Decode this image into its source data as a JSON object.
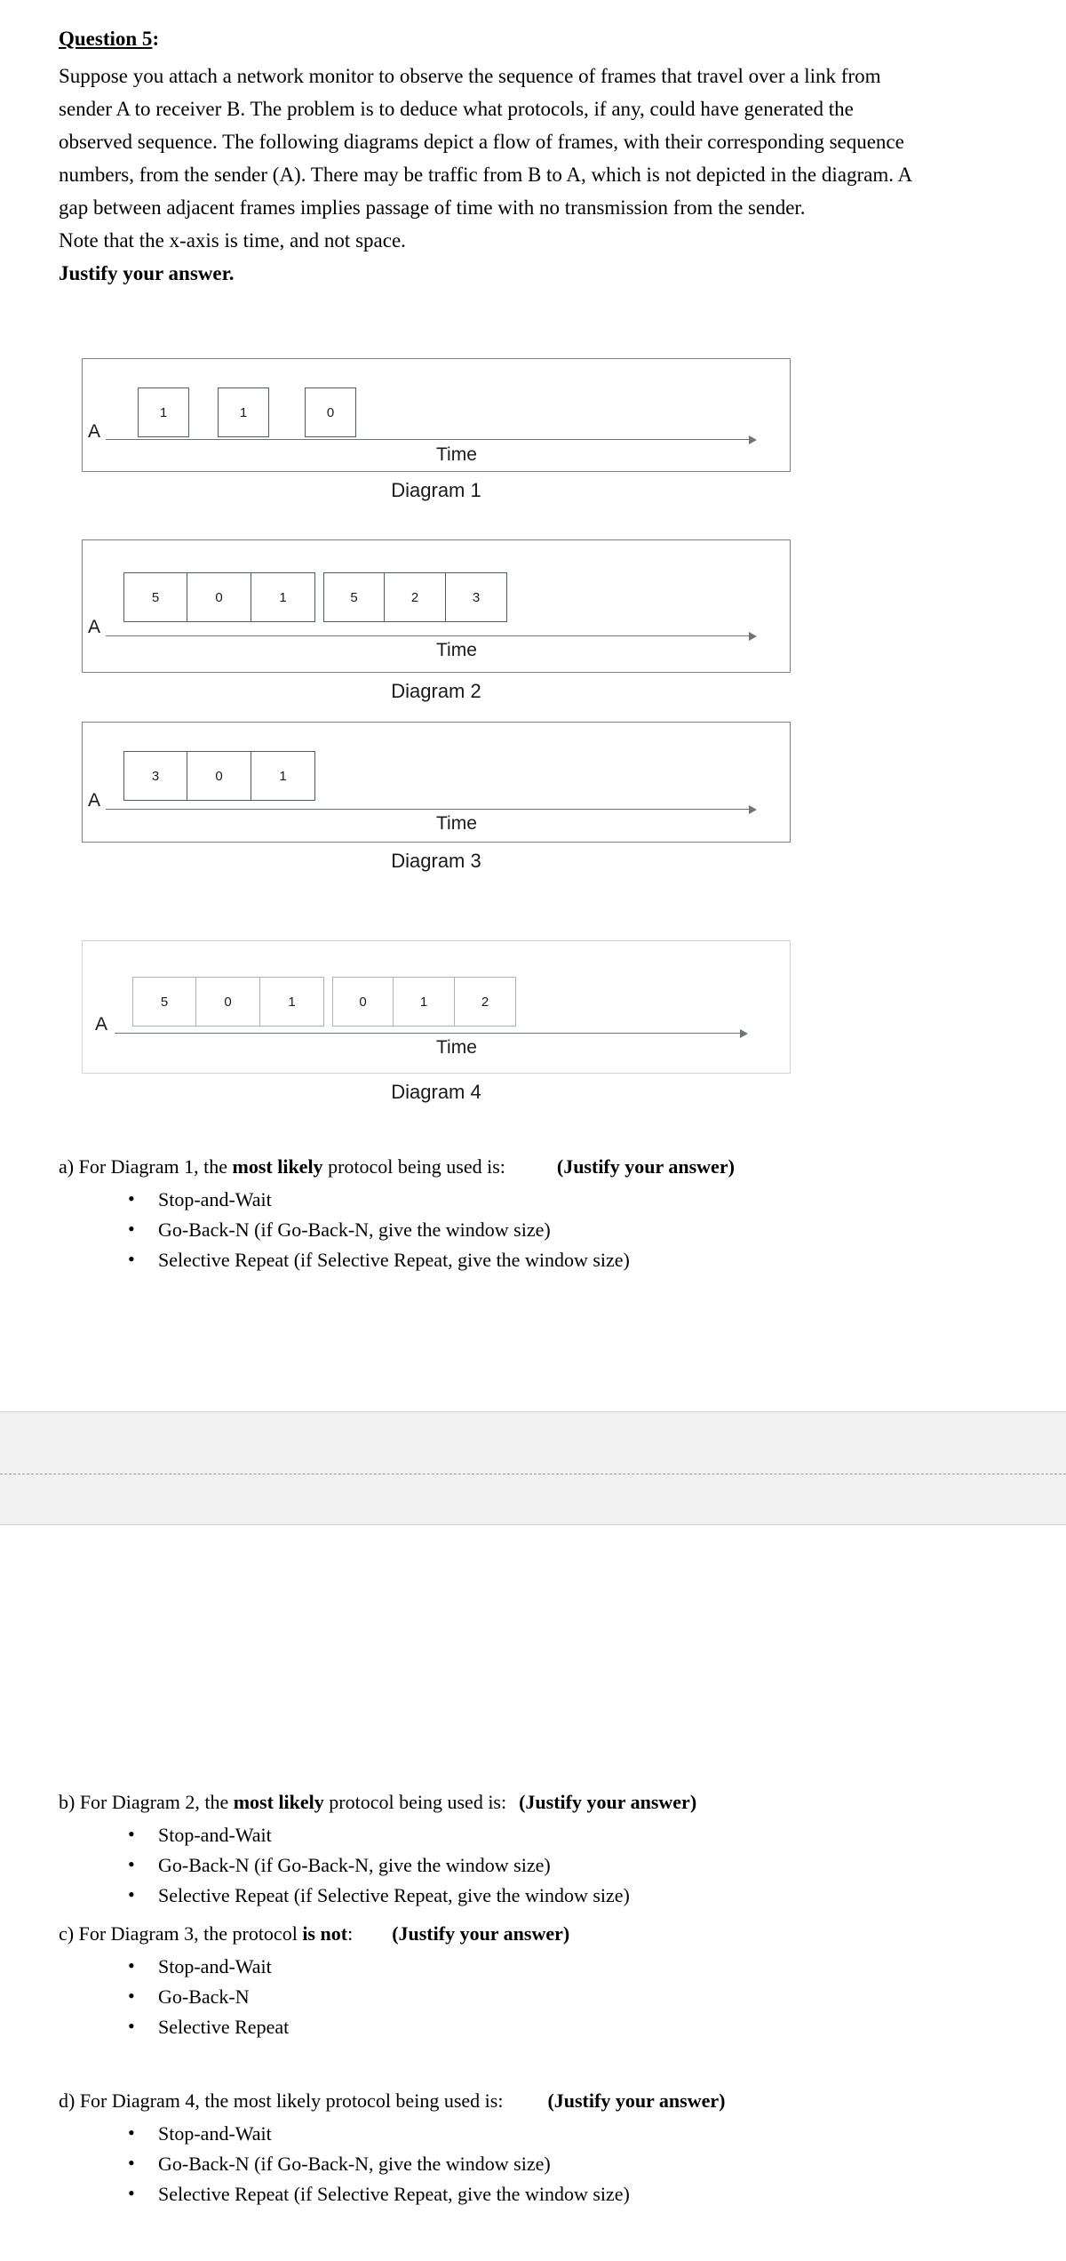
{
  "document": {
    "question_heading": "Question 5",
    "question_heading_suffix": ":",
    "intro_paragraph": "Suppose you attach a network monitor to observe the sequence of frames that travel over a link from sender A to receiver B. The problem is to deduce what protocols, if any, could have generated the observed sequence. The following diagrams depict a flow of frames, with their corresponding sequence numbers, from the sender (A). There may be traffic from B to A, which is not depicted in the diagram. A gap between adjacent frames implies passage of time with no transmission from the sender.",
    "note_line": "Note that the x-axis is time, and not space.",
    "justify_line": "Justify your answer."
  },
  "diagrams": [
    {
      "caption": "Diagram 1",
      "axis_origin_label": "A",
      "axis_label": "Time",
      "groups": [
        [
          "1"
        ],
        [
          "1"
        ],
        [
          "0"
        ]
      ]
    },
    {
      "caption": "Diagram 2",
      "axis_origin_label": "A",
      "axis_label": "Time",
      "groups": [
        [
          "5",
          "0",
          "1"
        ],
        [
          "5",
          "2",
          "3"
        ]
      ]
    },
    {
      "caption": "Diagram 3",
      "axis_origin_label": "A",
      "axis_label": "Time",
      "groups": [
        [
          "3",
          "0",
          "1"
        ]
      ]
    },
    {
      "caption": "Diagram 4",
      "axis_origin_label": "A",
      "axis_label": "Time",
      "groups": [
        [
          "5",
          "0",
          "1"
        ],
        [
          "0",
          "1",
          "2"
        ]
      ]
    }
  ],
  "questions": {
    "a": {
      "prefix": "a) For Diagram 1, the ",
      "emphasis": "most likely",
      "suffix": " protocol being used is:",
      "justify_tag": "(Justify your answer)",
      "options": [
        "Stop-and-Wait",
        "Go-Back-N (if Go-Back-N, give the window size)",
        "Selective Repeat (if Selective Repeat, give the window size)"
      ]
    },
    "b": {
      "prefix": "b) For Diagram 2, the ",
      "emphasis": "most likely",
      "suffix": " protocol being used is:",
      "justify_tag": "(Justify your answer)",
      "options": [
        "Stop-and-Wait",
        "Go-Back-N (if Go-Back-N, give the window size)",
        "Selective Repeat (if Selective Repeat, give the window size)"
      ]
    },
    "c": {
      "prefix": "c) For Diagram 3, the protocol ",
      "emphasis": "is not",
      "suffix": ":",
      "justify_tag": "(Justify your answer)",
      "options": [
        "Stop-and-Wait",
        "Go-Back-N",
        "Selective Repeat"
      ]
    },
    "d": {
      "prefix": "d) For Diagram 4, the most likely protocol being used is:",
      "emphasis": "",
      "suffix": "",
      "justify_tag": "(Justify your answer)",
      "options": [
        "Stop-and-Wait",
        "Go-Back-N (if Go-Back-N, give the window size)",
        "Selective Repeat (if Selective Repeat, give the window size)"
      ]
    }
  },
  "colors": {
    "page_background": "#ffffff",
    "text": "#000000",
    "diagram_border": "#808080",
    "frame_border": "#555a5e",
    "axis": "#6f7479",
    "panel_background": "#f1f1f1",
    "panel_border": "#d0d2d6",
    "dashed_divider": "#9aa0a6"
  }
}
